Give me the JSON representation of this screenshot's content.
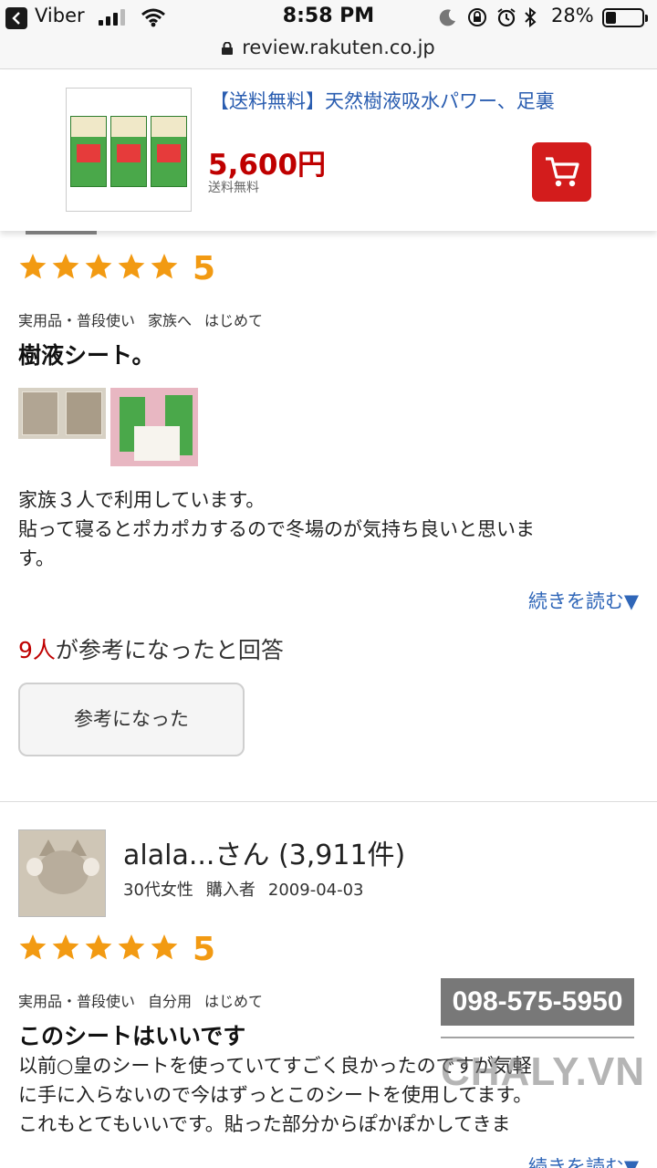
{
  "status_bar": {
    "app": "Viber",
    "time": "8:58 PM",
    "battery": "28%",
    "battery_level": 0.28
  },
  "url_bar": {
    "url": "review.rakuten.co.jp"
  },
  "product": {
    "title": "【送料無料】天然樹液吸水パワー、足裏",
    "price": "5,600円",
    "shipping": "送料無料"
  },
  "review1": {
    "rating": "5",
    "tags": [
      "実用品・普段使い",
      "家族へ",
      "はじめて"
    ],
    "title": "樹液シート。",
    "body_lines": [
      "家族３人で利用しています。",
      "貼って寝るとポカポカするので冬場のが気持ち良いと思いま",
      "す。"
    ],
    "read_more": "続きを読む▼",
    "helpful_count": "9人",
    "helpful_suffix": "が参考になったと回答",
    "helpful_button": "参考になった"
  },
  "review2": {
    "reviewer_name": "alala...さん (3,911件)",
    "meta": [
      "30代女性",
      "購入者",
      "2009-04-03"
    ],
    "rating": "5",
    "tags": [
      "実用品・普段使い",
      "自分用",
      "はじめて"
    ],
    "title": "このシートはいいです",
    "body_lines": [
      "以前○皇のシートを使っていてすごく良かったのですが気軽",
      "に手に入らないので今はずっとこのシートを使用してます。",
      "これもとてもいいです。貼った部分からぽかぽかしてきま"
    ],
    "read_more": "続きを読む▼"
  },
  "watermark": {
    "phone": "098-575-5950",
    "brand": "CHALY.VN"
  },
  "colors": {
    "price": "#bf0000",
    "link": "#2f66b8",
    "star": "#f29a12",
    "cart": "#d31c1c"
  }
}
